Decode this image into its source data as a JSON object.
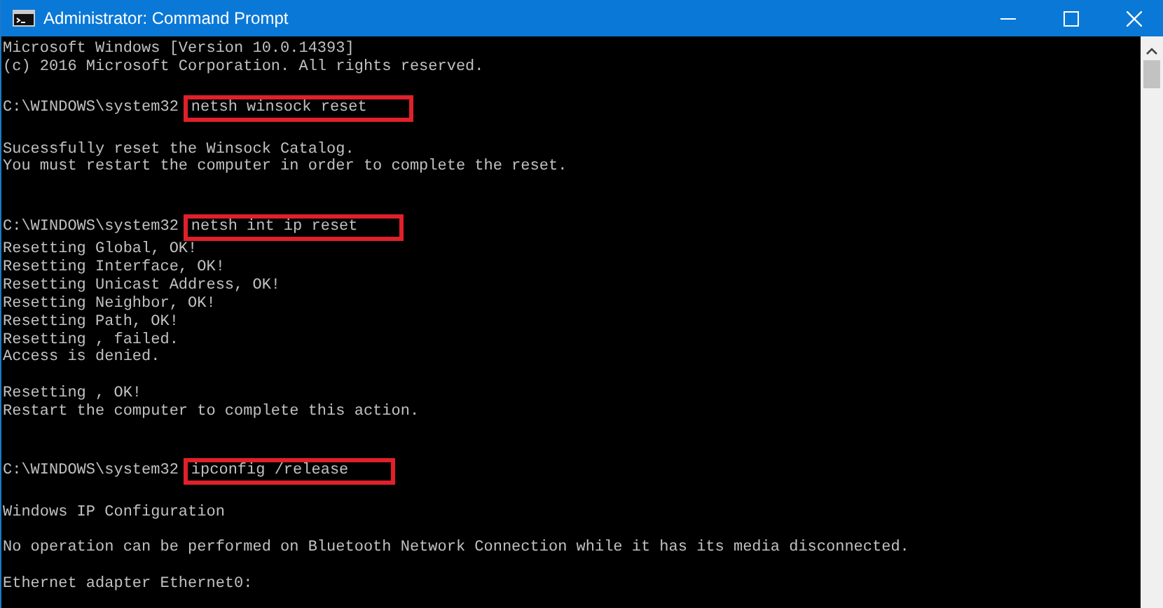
{
  "window": {
    "title": "Administrator: Command Prompt"
  },
  "console": {
    "lines": [
      {
        "kind": "text",
        "text": "Microsoft Windows [Version 10.0.14393]"
      },
      {
        "kind": "text",
        "text": "(c) 2016 Microsoft Corporation. All rights reserved."
      },
      {
        "kind": "blank"
      },
      {
        "kind": "command",
        "prompt": "C:\\WINDOWS\\system32",
        "command": "netsh winsock reset",
        "highlighted": true
      },
      {
        "kind": "blank"
      },
      {
        "kind": "text",
        "text": "Sucessfully reset the Winsock Catalog."
      },
      {
        "kind": "text",
        "text": "You must restart the computer in order to complete the reset."
      },
      {
        "kind": "blank"
      },
      {
        "kind": "blank"
      },
      {
        "kind": "command",
        "prompt": "C:\\WINDOWS\\system32",
        "command": "netsh int ip reset",
        "highlighted": true
      },
      {
        "kind": "text",
        "text": "Resetting Global, OK!"
      },
      {
        "kind": "text",
        "text": "Resetting Interface, OK!"
      },
      {
        "kind": "text",
        "text": "Resetting Unicast Address, OK!"
      },
      {
        "kind": "text",
        "text": "Resetting Neighbor, OK!"
      },
      {
        "kind": "text",
        "text": "Resetting Path, OK!"
      },
      {
        "kind": "text",
        "text": "Resetting , failed."
      },
      {
        "kind": "text",
        "text": "Access is denied."
      },
      {
        "kind": "blank"
      },
      {
        "kind": "text",
        "text": "Resetting , OK!"
      },
      {
        "kind": "text",
        "text": "Restart the computer to complete this action."
      },
      {
        "kind": "blank"
      },
      {
        "kind": "blank"
      },
      {
        "kind": "command",
        "prompt": "C:\\WINDOWS\\system32",
        "command": "ipconfig /release",
        "highlighted": true
      },
      {
        "kind": "blank"
      },
      {
        "kind": "text",
        "text": "Windows IP Configuration"
      },
      {
        "kind": "blank"
      },
      {
        "kind": "text",
        "text": "No operation can be performed on Bluetooth Network Connection while it has its media disconnected."
      },
      {
        "kind": "blank"
      },
      {
        "kind": "text",
        "text": "Ethernet adapter Ethernet0:"
      }
    ]
  }
}
